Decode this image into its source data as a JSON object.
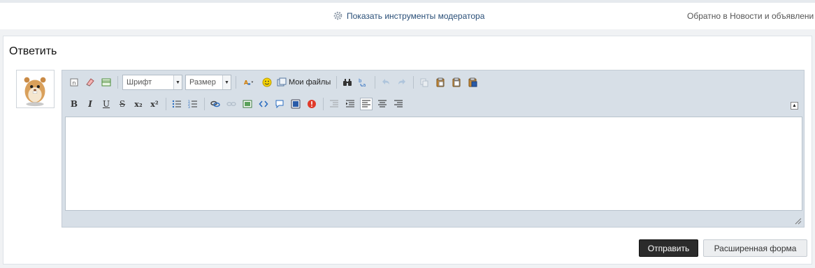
{
  "topbar": {
    "moderator_tools": "Показать инструменты модератора",
    "back_link": "Обратно в Новости и объявлени"
  },
  "reply": {
    "title": "Ответить",
    "font_select": "Шрифт",
    "size_select": "Размер",
    "my_files": "Мои файлы",
    "bold": "B",
    "italic": "I",
    "underline": "U",
    "strike": "S",
    "subscript": "x₂",
    "superscript": "x²",
    "send_button": "Отправить",
    "extended_button": "Расширенная форма"
  },
  "colors": {
    "accent_link": "#2a4f78",
    "toolbar_bg": "#d7dfe7",
    "send_bg": "#2b2b2b"
  }
}
